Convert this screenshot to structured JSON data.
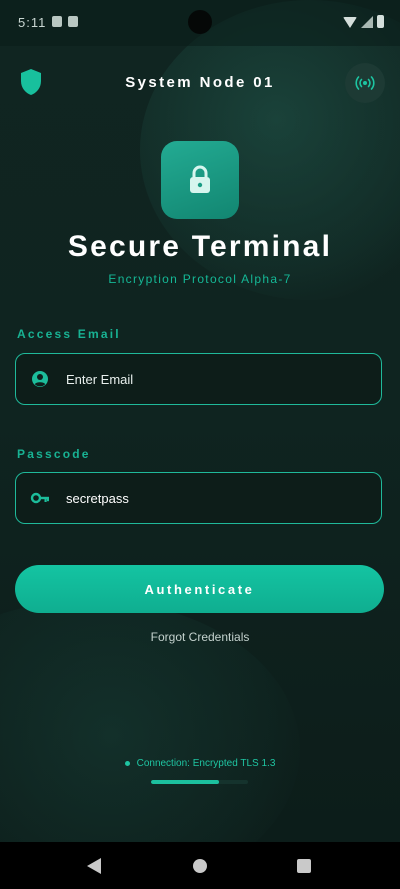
{
  "status_bar": {
    "time": "5:11"
  },
  "header": {
    "title": "System Node 01",
    "left_icon": "shield-icon",
    "right_icon": "broadcast-signal-icon"
  },
  "hero": {
    "icon": "lock-icon",
    "title": "Secure Terminal",
    "subtitle": "Encryption Protocol Alpha-7"
  },
  "form": {
    "email": {
      "label": "Access Email",
      "placeholder": "Enter Email",
      "value": "",
      "icon": "user-circle-icon"
    },
    "passcode": {
      "label": "Passcode",
      "placeholder": "",
      "value": "secretpass",
      "icon": "key-icon"
    },
    "submit_label": "Authenticate",
    "forgot_label": "Forgot Credentials"
  },
  "footer": {
    "connection_status": "Connection: Encrypted TLS 1.3",
    "progress_fraction": 0.7
  },
  "colors": {
    "accent": "#14c4a2",
    "background": "#0f2420",
    "label": "#18b293"
  },
  "nav": {
    "back_icon": "back-triangle-icon",
    "home_icon": "home-circle-icon",
    "recents_icon": "recents-square-icon"
  }
}
